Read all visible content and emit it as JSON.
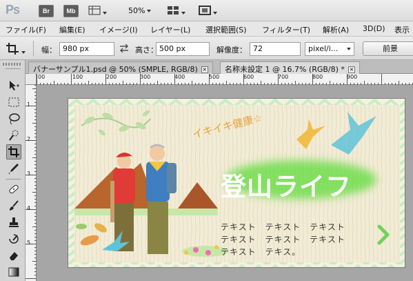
{
  "app": {
    "logo": "Ps",
    "bridge_label": "Br",
    "minibridge_label": "Mb",
    "zoom_value": "50%"
  },
  "menu": [
    "ファイル(F)",
    "編集(E)",
    "イメージ(I)",
    "レイヤー(L)",
    "選択範囲(S)",
    "フィルター(T)",
    "解析(A)",
    "3D(D)",
    "表示"
  ],
  "options": {
    "width_label": "幅：",
    "width_value": "980 px",
    "height_label": "高さ：",
    "height_value": "500 px",
    "resolution_label": "解像度：",
    "resolution_value": "72",
    "unit_value": "pixel/i...",
    "front_image_label": "前景"
  },
  "tabs": [
    {
      "label": "バナーサンプル1.psd @ 50% (SMPLE, RGB/8)",
      "close": "×"
    },
    {
      "label": "名称未設定 1 @ 16.7% (RGB/8) *",
      "close": "×"
    }
  ],
  "ruler_h": [
    "00",
    "100",
    "200",
    "300",
    "400",
    "500",
    "600",
    "700",
    "800",
    "900"
  ],
  "ruler_v": [
    "1",
    "2",
    "3",
    "4",
    "5"
  ],
  "banner": {
    "tagline": "イキイキ健康☆",
    "title": "登山ライフ",
    "text_lines": [
      "テキスト　テキスト　テキスト",
      "テキスト　テキスト　テキスト",
      "テキスト　テキス。"
    ],
    "colors": {
      "title_glow": "#5fdc3a",
      "tagline": "#e8a23c",
      "arrow": "#6fd15a",
      "bird_blue": "#5fc3d8",
      "bird_yellow": "#f0b93a"
    }
  }
}
